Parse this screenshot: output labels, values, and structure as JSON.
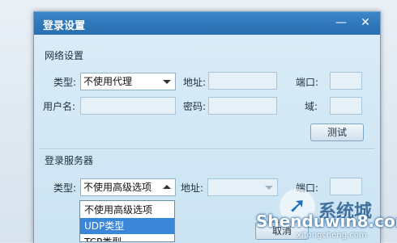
{
  "dialog": {
    "title": "登录设置",
    "minimize_glyph": "—",
    "close_glyph": "✕"
  },
  "network": {
    "section_title": "网络设置",
    "type_label": "类型:",
    "type_value": "不使用代理",
    "address_label": "地址:",
    "port_label": "端口:",
    "username_label": "用户名:",
    "password_label": "密码:",
    "domain_label": "域:",
    "test_button": "测试"
  },
  "login_server": {
    "section_title": "登录服务器",
    "type_label": "类型:",
    "type_value": "不使用高级选项",
    "address_label": "地址:",
    "port_label": "端口:",
    "cancel_button": "取消"
  },
  "dropdown": {
    "options": [
      "不使用高级选项",
      "UDP类型",
      "TCP类型"
    ],
    "selected_index": 1
  },
  "watermark": {
    "cn_text": "系统城",
    "en_text": "Shenduwin8.com",
    "url_text": "xitongcheng.com"
  },
  "colors": {
    "titlebar": "#2f77ba",
    "selection": "#3b86d8"
  }
}
